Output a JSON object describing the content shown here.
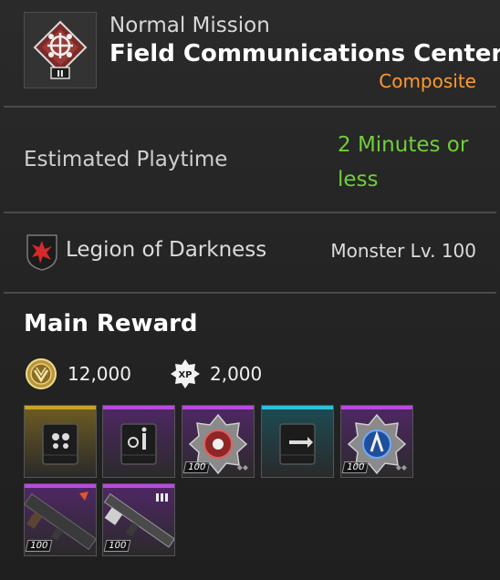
{
  "mission": {
    "type": "Normal Mission",
    "name": "Field Communications Center",
    "tag": "Composite",
    "tag_color": "#ff9a2e",
    "icon": "mission-emblem-icon",
    "rank": "II"
  },
  "playtime": {
    "label": "Estimated Playtime",
    "value": "2 Minutes or less",
    "value_color": "#6fcf3a"
  },
  "enemy": {
    "icon": "legion-of-darkness-icon",
    "name": "Legion of Darkness",
    "level": "Monster Lv. 100"
  },
  "rewards": {
    "title": "Main Reward",
    "currency": [
      {
        "icon": "gold-coin-icon",
        "amount": "12,000"
      },
      {
        "icon": "xp-icon",
        "label": "XP",
        "amount": "2,000"
      }
    ],
    "items": [
      {
        "icon": "gold-module-icon",
        "rarity_color": "#c9a227"
      },
      {
        "icon": "purple-module-icon",
        "rarity_color": "#b94ae0"
      },
      {
        "icon": "red-core-icon",
        "rarity_color": "#b94ae0",
        "level": "100"
      },
      {
        "icon": "blue-module-icon",
        "rarity_color": "#2bc2d9"
      },
      {
        "icon": "blue-core-icon",
        "rarity_color": "#b94ae0",
        "level": "100"
      },
      {
        "icon": "weapon-launcher-icon",
        "rarity_color": "#b94ae0",
        "level": "100"
      },
      {
        "icon": "weapon-rifle-icon",
        "rarity_color": "#b94ae0",
        "level": "100"
      }
    ]
  }
}
